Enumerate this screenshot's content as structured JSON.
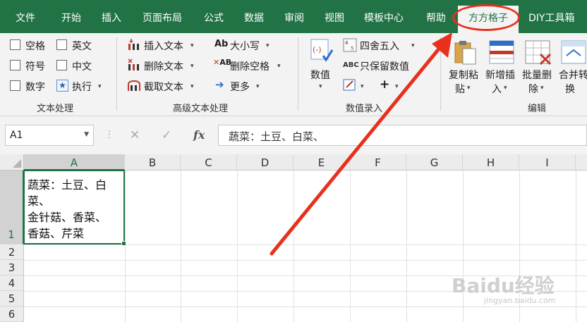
{
  "tabs": [
    {
      "label": "文件"
    },
    {
      "label": "开始"
    },
    {
      "label": "插入"
    },
    {
      "label": "页面布局"
    },
    {
      "label": "公式"
    },
    {
      "label": "数据"
    },
    {
      "label": "审阅"
    },
    {
      "label": "视图"
    },
    {
      "label": "模板中心"
    },
    {
      "label": "帮助"
    },
    {
      "label": "方方格子"
    },
    {
      "label": "DIY工具箱"
    }
  ],
  "ribbon": {
    "text_group": {
      "checkboxes": [
        "空格",
        "英文",
        "符号",
        "中文",
        "数字"
      ],
      "execute": "执行",
      "label": "文本处理"
    },
    "adv_group": {
      "insert_text": "插入文本",
      "delete_text": "删除文本",
      "extract_text": "截取文本",
      "case": "大小写",
      "delete_space": "删除空格",
      "more": "更多",
      "label": "高级文本处理"
    },
    "num_group": {
      "value": "数值",
      "round": "四舍五入",
      "keep_value": "只保留数值",
      "plus": "+",
      "label": "数值录入"
    },
    "edit_group": {
      "copy_paste": [
        "复制粘",
        "贴"
      ],
      "new_insert": [
        "新增插",
        "入"
      ],
      "batch_delete": [
        "批量删",
        "除"
      ],
      "merge_convert": [
        "合并转",
        "换"
      ],
      "label": "编辑"
    }
  },
  "formula_bar": {
    "name_box": "A1",
    "fx": "fx",
    "content": "蔬菜：土豆、白菜、"
  },
  "columns": [
    "A",
    "B",
    "C",
    "D",
    "E",
    "F",
    "G",
    "H",
    "I"
  ],
  "rows": [
    "1",
    "2",
    "3",
    "4",
    "5",
    "6"
  ],
  "cell_a1": "蔬菜：土豆、白\n菜、\n金针菇、香菜、\n香菇、芹菜",
  "watermark": {
    "main": "Baidu经验",
    "sub": "jingyan.baidu.com"
  }
}
